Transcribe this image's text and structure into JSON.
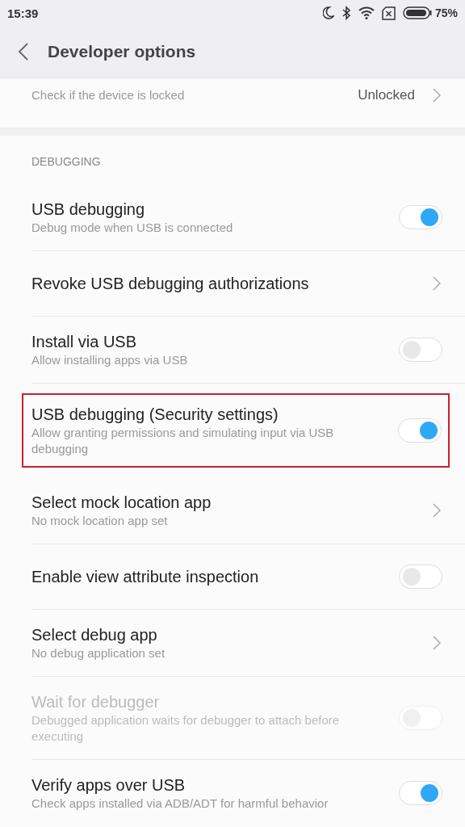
{
  "status_bar": {
    "time": "15:39",
    "battery": "75%"
  },
  "header": {
    "title": "Developer options"
  },
  "sections": [
    {
      "rows": [
        {
          "kind": "value",
          "subtitle": "Check if the device is locked",
          "value": "Unlocked",
          "disabled": false,
          "highlighted": false
        }
      ]
    },
    {
      "title": "DEBUGGING",
      "rows": [
        {
          "kind": "toggle",
          "title": "USB debugging",
          "subtitle": "Debug mode when USB is connected",
          "on": true,
          "disabled": false,
          "highlighted": false
        },
        {
          "kind": "link",
          "title": "Revoke USB debugging authorizations",
          "disabled": false,
          "highlighted": false
        },
        {
          "kind": "toggle",
          "title": "Install via USB",
          "subtitle": "Allow installing apps via USB",
          "on": false,
          "disabled": false,
          "highlighted": false
        },
        {
          "kind": "toggle",
          "title": "USB debugging (Security settings)",
          "subtitle": "Allow granting permissions and simulating input via USB debugging",
          "on": true,
          "disabled": false,
          "highlighted": true
        },
        {
          "kind": "link",
          "title": "Select mock location app",
          "subtitle": "No mock location app set",
          "disabled": false,
          "highlighted": false
        },
        {
          "kind": "toggle",
          "title": "Enable view attribute inspection",
          "on": false,
          "disabled": false,
          "highlighted": false
        },
        {
          "kind": "link",
          "title": "Select debug app",
          "subtitle": "No debug application set",
          "disabled": false,
          "highlighted": false
        },
        {
          "kind": "toggle",
          "title": "Wait for debugger",
          "subtitle": "Debugged application waits for debugger to attach before executing",
          "on": false,
          "disabled": true,
          "highlighted": false
        },
        {
          "kind": "toggle",
          "title": "Verify apps over USB",
          "subtitle": "Check apps installed via ADB/ADT for harmful behavior",
          "on": true,
          "disabled": false,
          "highlighted": false
        }
      ]
    }
  ]
}
